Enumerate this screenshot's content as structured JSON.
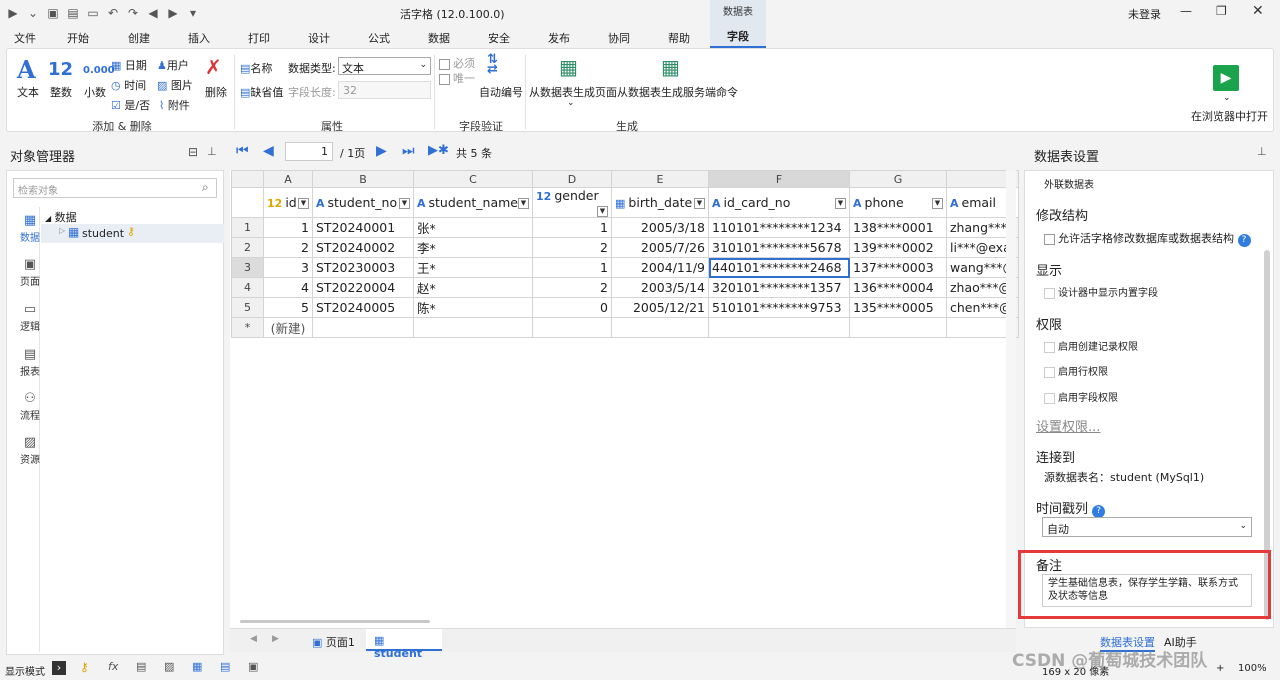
{
  "window": {
    "title": "活字格 (12.0.100.0)",
    "context_tab_group": "数据表",
    "login": "未登录"
  },
  "menu": [
    "文件",
    "开始",
    "创建",
    "插入",
    "打印",
    "设计",
    "公式",
    "数据",
    "安全",
    "发布",
    "协同",
    "帮助",
    "字段"
  ],
  "ribbon": {
    "add_delete": {
      "label": "添加 & 删除",
      "text": "文本",
      "int": "整数",
      "decimal": "小数",
      "date": "日期",
      "time": "时间",
      "bool": "是/否",
      "user": "用户",
      "image": "图片",
      "attach": "附件",
      "delete": "删除",
      "int_icon": "12",
      "dec_icon": "0.000"
    },
    "props": {
      "label": "属性",
      "name": "名称",
      "default": "缺省值",
      "data_type_label": "数据类型:",
      "data_type_value": "文本",
      "length_label": "字段长度:",
      "length_value": "32"
    },
    "validation": {
      "label": "字段验证",
      "required": "必须",
      "unique": "唯一",
      "autonum": "自动编号"
    },
    "generate": {
      "label": "生成",
      "from_page": "从数据表生成页面",
      "from_cmd": "从数据表生成服务端命令"
    },
    "open_browser": "在浏览器中打开"
  },
  "object_manager": {
    "title": "对象管理器",
    "search_placeholder": "检索对象",
    "tree_root": "数据",
    "tree_item": "student",
    "nav": [
      "数据",
      "页面",
      "逻辑",
      "报表",
      "流程",
      "资源"
    ]
  },
  "nav_bar": {
    "page": "1",
    "page_total": "/ 1页",
    "record_count": "共 5 条"
  },
  "grid": {
    "col_letters": [
      "A",
      "B",
      "C",
      "D",
      "E",
      "F",
      "G",
      ""
    ],
    "fields": [
      {
        "t": "12",
        "n": "id"
      },
      {
        "t": "A",
        "n": "student_no"
      },
      {
        "t": "A",
        "n": "student_name"
      },
      {
        "t": "12",
        "n": "gender"
      },
      {
        "t": "▦",
        "n": "birth_date"
      },
      {
        "t": "A",
        "n": "id_card_no"
      },
      {
        "t": "A",
        "n": "phone"
      },
      {
        "t": "A",
        "n": "email"
      }
    ],
    "rows": [
      [
        "1",
        "1",
        "ST20240001",
        "张*",
        "1",
        "2005/3/18",
        "110101********1234",
        "138****0001",
        "zhang***"
      ],
      [
        "2",
        "2",
        "ST20240002",
        "李*",
        "2",
        "2005/7/26",
        "310101********5678",
        "139****0002",
        "li***@exa"
      ],
      [
        "3",
        "3",
        "ST20230003",
        "王*",
        "1",
        "2004/11/9",
        "440101********2468",
        "137****0003",
        "wang***@"
      ],
      [
        "4",
        "4",
        "ST20220004",
        "赵*",
        "2",
        "2003/5/14",
        "320101********1357",
        "136****0004",
        "zhao***@"
      ],
      [
        "5",
        "5",
        "ST20240005",
        "陈*",
        "0",
        "2005/12/21",
        "510101********9753",
        "135****0005",
        "chen***@"
      ]
    ],
    "new_row_marker": "*",
    "new_row_label": "(新建)"
  },
  "sheet_tabs": [
    "页面1",
    "student"
  ],
  "settings": {
    "title": "数据表设置",
    "external": "外联数据表",
    "modify_h": "修改结构",
    "modify_opt": "允许活字格修改数据库或数据表结构",
    "show_h": "显示",
    "show_opt": "设计器中显示内置字段",
    "perm_h": "权限",
    "perm1": "启用创建记录权限",
    "perm2": "启用行权限",
    "perm3": "启用字段权限",
    "perm_link": "设置权限...",
    "conn_h": "连接到",
    "conn_val": "源数据表名：student (MySql1)",
    "ts_h": "时间戳列",
    "ts_val": "自动",
    "note_h": "备注",
    "note_val": "学生基础信息表，保存学生学籍、联系方式及状态等信息",
    "tab1": "数据表设置",
    "tab2": "AI助手"
  },
  "status": {
    "mode": "显示模式",
    "size": "169 x 20 像素",
    "zoom": "100%",
    "watermark": "CSDN @葡萄城技术团队"
  }
}
